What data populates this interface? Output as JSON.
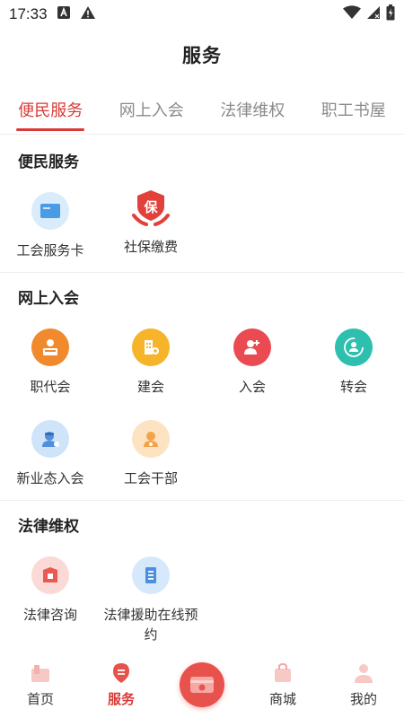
{
  "status_bar": {
    "time": "17:33"
  },
  "header": {
    "title": "服务"
  },
  "tabs": [
    {
      "label": "便民服务",
      "active": true
    },
    {
      "label": "网上入会",
      "active": false
    },
    {
      "label": "法律维权",
      "active": false
    },
    {
      "label": "职工书屋",
      "active": false
    }
  ],
  "sections": {
    "convenience": {
      "title": "便民服务",
      "items": [
        {
          "label": "工会服务卡",
          "icon": "card-icon"
        },
        {
          "label": "社保缴费",
          "icon": "social-security-icon",
          "badge": "保"
        }
      ]
    },
    "join": {
      "title": "网上入会",
      "items": [
        {
          "label": "职代会",
          "icon": "podium-icon"
        },
        {
          "label": "建会",
          "icon": "building-icon"
        },
        {
          "label": "入会",
          "icon": "add-user-icon"
        },
        {
          "label": "转会",
          "icon": "transfer-user-icon"
        },
        {
          "label": "新业态入会",
          "icon": "new-worker-icon"
        },
        {
          "label": "工会干部",
          "icon": "cadre-icon"
        }
      ]
    },
    "legal": {
      "title": "法律维权",
      "items": [
        {
          "label": "法律咨询",
          "icon": "consult-icon"
        },
        {
          "label": "法律援助在线预约",
          "icon": "legal-doc-icon"
        }
      ]
    }
  },
  "bottom_nav": [
    {
      "label": "首页",
      "active": false
    },
    {
      "label": "服务",
      "active": true
    },
    {
      "label": "商城",
      "active": false
    },
    {
      "label": "我的",
      "active": false
    }
  ],
  "colors": {
    "accent": "#d83a35",
    "text": "#222222",
    "muted": "#8a8a8a"
  }
}
